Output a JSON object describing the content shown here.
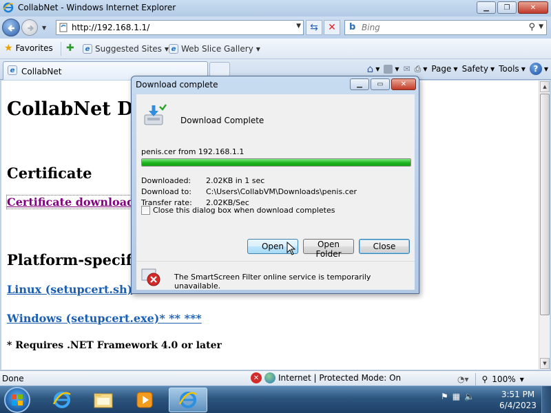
{
  "window": {
    "title": "CollabNet - Windows Internet Explorer",
    "caption_buttons": [
      "minimize",
      "maximize",
      "close"
    ]
  },
  "address_bar": {
    "url": "http://192.168.1.1/",
    "search_placeholder": "Bing"
  },
  "favorites_bar": {
    "favorites_label": "Favorites",
    "items": [
      {
        "label": "Suggested Sites",
        "icon": "ie-page-icon"
      },
      {
        "label": "Web Slice Gallery",
        "icon": "ie-page-icon"
      }
    ]
  },
  "tabs": [
    {
      "label": "CollabNet",
      "active": true
    }
  ],
  "command_bar": {
    "page_label": "Page",
    "safety_label": "Safety",
    "tools_label": "Tools"
  },
  "page": {
    "heading": "CollabNet Do",
    "section_certificate": "Certificate",
    "certificate_link": "Certificate download (",
    "section_platform": "Platform-specific",
    "linux_link": "Linux (setupcert.sh)",
    "windows_link": "Windows (setupcert.exe)* ** ***",
    "requirement_note": "* Requires .NET Framework 4.0 or later"
  },
  "status_bar": {
    "status_text": "Done",
    "zone_text": "Internet | Protected Mode: On",
    "zoom": "100%"
  },
  "taskbar": {
    "items": [
      {
        "name": "internet-explorer",
        "active": false
      },
      {
        "name": "windows-explorer",
        "active": false
      },
      {
        "name": "media-player",
        "active": false
      },
      {
        "name": "internet-explorer",
        "active": true
      }
    ],
    "time": "3:51 PM",
    "date": "6/4/2023"
  },
  "download_dialog": {
    "title": "Download complete",
    "heading": "Download Complete",
    "file_line": "penis.cer from 192.168.1.1",
    "progress_fraction": 1.0,
    "rows": [
      {
        "label": "Downloaded:",
        "value": "2.02KB in 1 sec"
      },
      {
        "label": "Download to:",
        "value": "C:\\Users\\CollabVM\\Downloads\\penis.cer"
      },
      {
        "label": "Transfer rate:",
        "value": "2.02KB/Sec"
      }
    ],
    "close_when_done_label": "Close this dialog box when download completes",
    "close_when_done_checked": false,
    "buttons": {
      "open": "Open",
      "open_folder": "Open Folder",
      "close": "Close"
    },
    "smartscreen_text": "The SmartScreen Filter online service is temporarily unavailable."
  },
  "colors": {
    "visited_link": "#800080",
    "link": "#1a5fb4",
    "progress_green": "#1fb51f"
  }
}
